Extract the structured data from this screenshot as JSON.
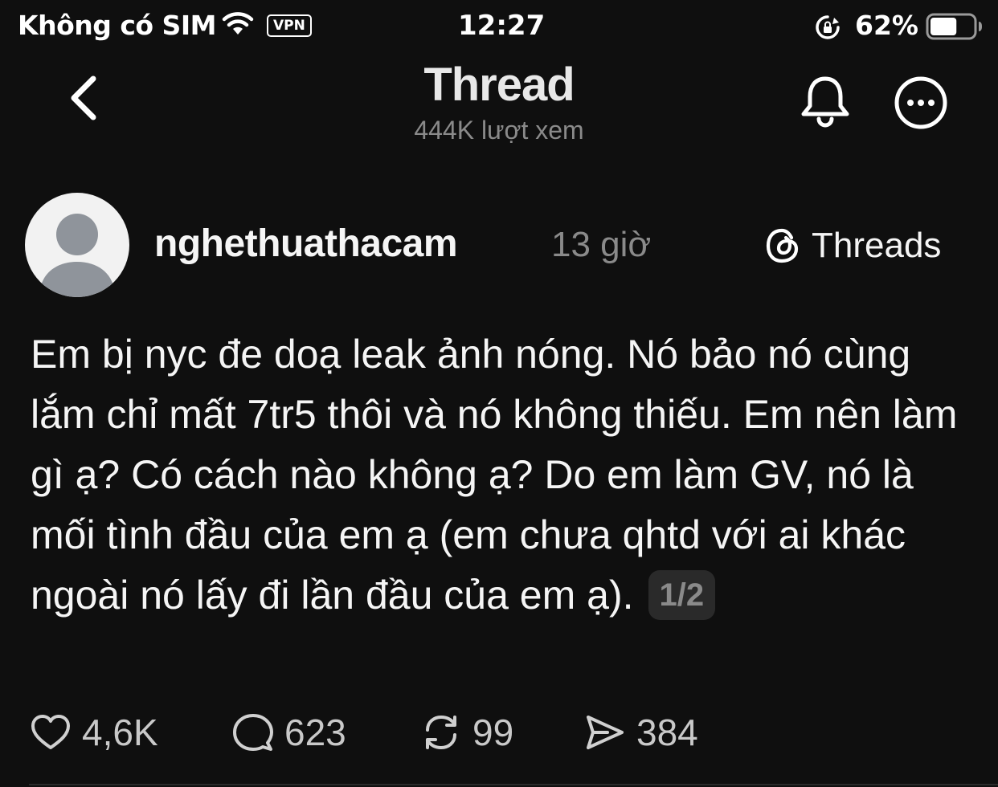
{
  "status_bar": {
    "carrier": "Không có SIM",
    "vpn": "VPN",
    "time": "12:27",
    "battery_percent": "62%",
    "battery_level": 0.62
  },
  "header": {
    "title": "Thread",
    "views": "444K lượt xem"
  },
  "post": {
    "username": "nghethuathacam",
    "time_ago": "13 giờ",
    "source_label": "Threads",
    "text": "Em bị nyc đe doạ leak ảnh nóng. Nó bảo nó cùng lắm chỉ mất 7tr5 thôi và nó không thiếu. Em nên làm gì ạ? Có cách nào không ạ? Do em làm GV, nó là mối tình đầu của em ạ (em chưa qhtd với ai khác ngoài nó lấy đi lần đầu của em ạ).",
    "page_indicator": "1/2"
  },
  "actions": {
    "likes": "4,6K",
    "comments": "623",
    "reposts": "99",
    "shares": "384"
  },
  "icons": {
    "back": "chevron-left-icon",
    "bell": "bell-icon",
    "more": "more-icon",
    "like": "heart-icon",
    "comment": "comment-icon",
    "repost": "repost-icon",
    "share": "send-icon"
  }
}
